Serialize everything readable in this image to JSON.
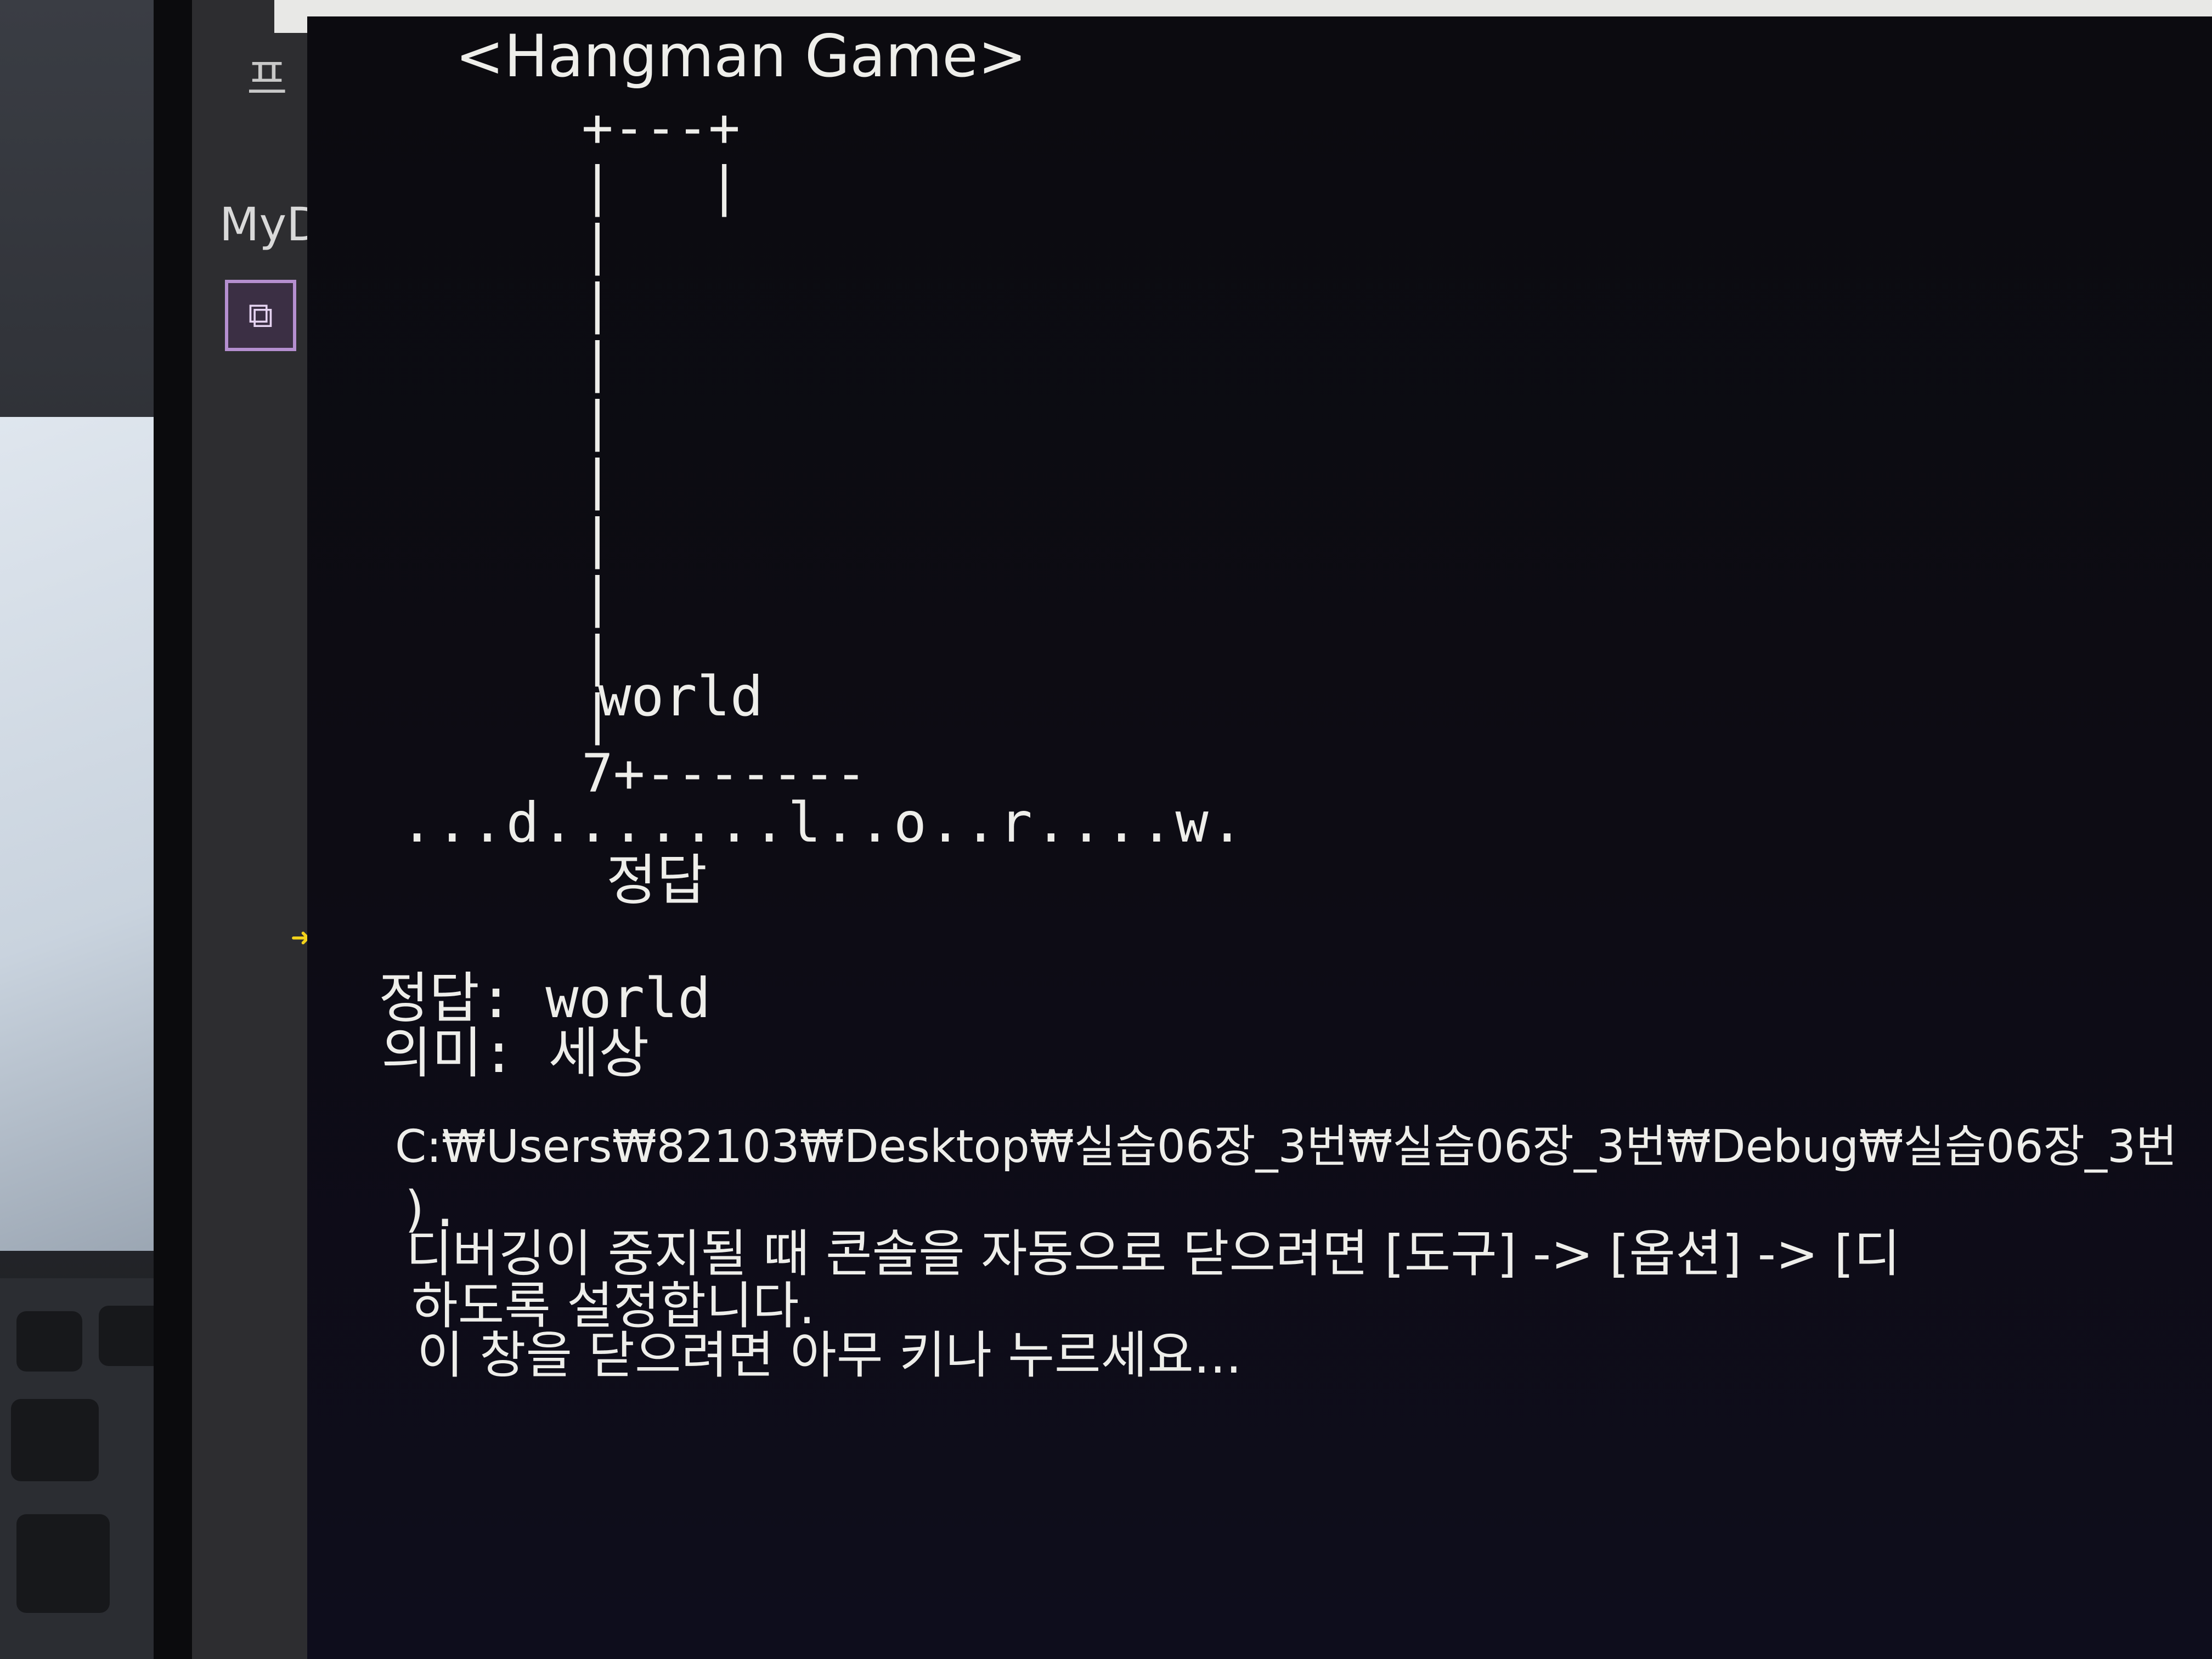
{
  "ide": {
    "tab_label": "MyD",
    "korean_glyph": "프",
    "toolbox_icon": "toolbox-icon",
    "breakpoint_icon": "current-line-arrow-icon"
  },
  "console": {
    "title": "<Hangman Game>",
    "gallows_lines": [
      "+---+",
      "|   |",
      "|",
      "|",
      "|",
      "|",
      "|",
      "|",
      "|",
      "|",
      "|",
      "7+-------"
    ],
    "word": "world",
    "guessed_letters": "...d.......l..o..r....w.",
    "correct_label": "정답",
    "answer": "정답: world",
    "meaning": "의미: 세상",
    "exe_path": "C:₩Users₩82103₩Desktop₩실습06장_3번₩실습06장_3번₩Debug₩실습06장_3번",
    "paren": ").",
    "close_msg_1": "디버깅이 중지될 때 콘솔을 자동으로 닫으려면 [도구] -> [옵션] -> [디",
    "close_msg_2": "하도록 설정합니다.",
    "close_msg_3": "이 창을 닫으려면 아무 키나 누르세요..."
  },
  "colors": {
    "console_bg": "#0c0b10",
    "console_text": "#eeeeea",
    "ide_panel": "#2d2d30",
    "breakpoint_arrow": "#f2d21b"
  }
}
